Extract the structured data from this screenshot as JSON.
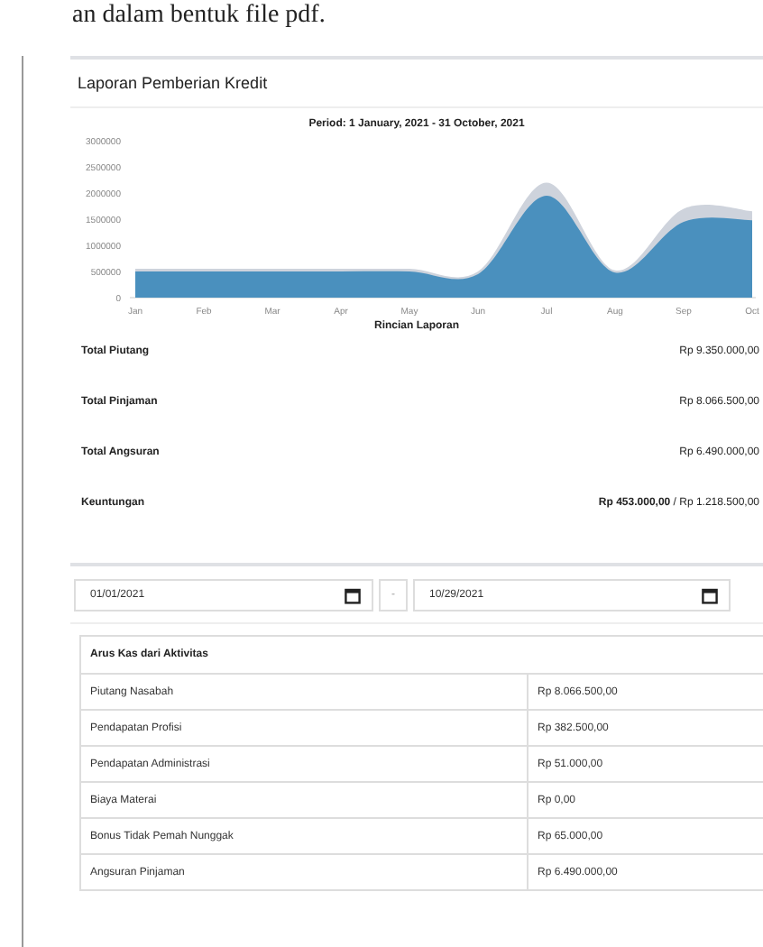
{
  "doc_text": "an dalam bentuk file pdf.",
  "card": {
    "title": "Laporan Pemberian Kredit",
    "chart_data": {
      "type": "area",
      "title": "Period: 1 January, 2021 - 31 October, 2021",
      "xlabel": "Rincian Laporan",
      "categories": [
        "Jan",
        "Feb",
        "Mar",
        "Apr",
        "May",
        "Jun",
        "Jul",
        "Aug",
        "Sep",
        "Oct"
      ],
      "series": [
        {
          "color": "#ced3dc",
          "values": [
            550000,
            550000,
            550000,
            550000,
            550000,
            500000,
            2200000,
            520000,
            1700000,
            1650000
          ]
        },
        {
          "color": "#4a90be",
          "values": [
            500000,
            500000,
            500000,
            500000,
            500000,
            450000,
            1950000,
            480000,
            1450000,
            1480000
          ]
        }
      ],
      "ylim": [
        0,
        3000000
      ],
      "yticks": [
        0,
        500000,
        1000000,
        1500000,
        2000000,
        2500000,
        3000000
      ]
    },
    "summary": [
      {
        "label": "Total Piutang",
        "value": "Rp 9.350.000,00"
      },
      {
        "label": "Total Pinjaman",
        "value": "Rp 8.066.500,00"
      },
      {
        "label": "Total Angsuran",
        "value": "Rp 6.490.000,00"
      },
      {
        "label": "Keuntungan",
        "value": "**Rp 453.000,00** / Rp 1.218.500,00"
      }
    ]
  },
  "date_range": {
    "from": "01/01/2021",
    "separator": "-",
    "to": "10/29/2021"
  },
  "table": {
    "title": "Arus Kas dari Aktivitas",
    "rows": [
      {
        "name": "Piutang Nasabah",
        "amount": "Rp 8.066.500,00"
      },
      {
        "name": "Pendapatan Profisi",
        "amount": "Rp 382.500,00"
      },
      {
        "name": "Pendapatan Administrasi",
        "amount": "Rp 51.000,00"
      },
      {
        "name": "Biaya Materai",
        "amount": "Rp 0,00"
      },
      {
        "name": "Bonus Tidak Pemah Nunggak",
        "amount": "Rp 65.000,00"
      },
      {
        "name": "Angsuran Pinjaman",
        "amount": "Rp 6.490.000,00"
      }
    ]
  }
}
